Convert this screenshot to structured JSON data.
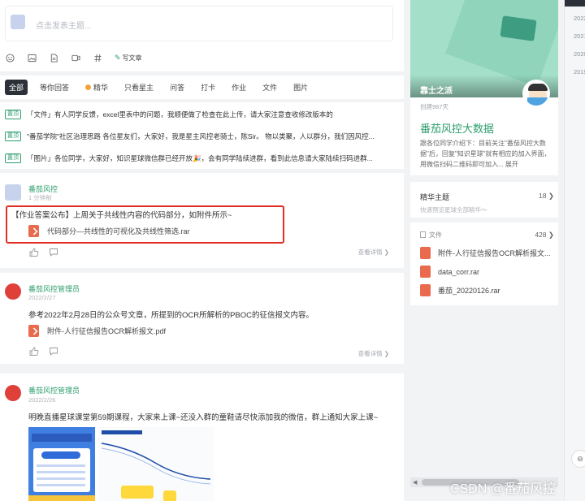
{
  "composer": {
    "placeholder": "点击发表主题..."
  },
  "toolbar": {
    "write_article": "写文章"
  },
  "filters": [
    {
      "label": "全部",
      "active": true
    },
    {
      "label": "等你回答"
    },
    {
      "label": "精华",
      "dot": true
    },
    {
      "label": "只看星主"
    },
    {
      "label": "问答"
    },
    {
      "label": "打卡"
    },
    {
      "label": "作业"
    },
    {
      "label": "文件"
    },
    {
      "label": "图片"
    }
  ],
  "pinned": [
    {
      "tag": "置顶",
      "text": "「文件」有人同学反馈，excel里表中的问题，我顺便做了检查在此上传，请大家注意查收修改版本的"
    },
    {
      "tag": "置顶",
      "text": "\"番茄学院\"社区治理思路 各位星友们，大家好，我是星主风控老骑士，陈Sir。 物以类聚，人以群分，我们因风控..."
    },
    {
      "tag": "置顶",
      "text": "「图片」各位同学，大家好，知识星球微信群已经开放🎉，会有同学陆续进群，看到此信息请大家陆续扫码进群..."
    }
  ],
  "posts": [
    {
      "author": "番茄风控",
      "time": "1 分钟前",
      "body": "【作业答案公布】上周关于共线性内容的代码部分，如附件所示~",
      "file": "代码部分—共线性的可视化及共线性筛选.rar",
      "more": "查看详情 ❯"
    },
    {
      "author": "番茄风控管理员",
      "time": "2022/2/27",
      "body": "参考2022年2月28日的公众号文章，所提到的OCR所解析的PBOC的征信报文内容。",
      "file": "附件-人行征信报告OCR解析报文.pdf",
      "more": "查看详情 ❯"
    },
    {
      "author": "番茄风控管理员",
      "time": "2022/2/26",
      "body": "明晚直播星球课堂第59期课程，大家来上课~还没入群的童鞋请尽快添加我的微信，群上通知大家上课~"
    }
  ],
  "group": {
    "banner_name": "靠士之派",
    "created": "创建987天",
    "name": "番茄风控大数据",
    "desc": "跟各位同学介绍下：目前关注\"番茄风控大数据\"后，回复\"知识星球\"就有相应的加入界面，用微信扫码二维码即可加入... 展开"
  },
  "highlights": {
    "label": "精华主题",
    "count": "18 ❯",
    "sub": "快速预览星球全部精华～"
  },
  "files": {
    "label": "文件",
    "count": "428 ❯",
    "items": [
      "附件-人行征信报告OCR解析报文...",
      "data_corr.rar",
      "番茄_20220126.rar"
    ]
  },
  "timeline": [
    "2022",
    "2021",
    "2020",
    "2019"
  ],
  "watermark": "CSDN @番茄风控",
  "colors": {
    "brand": "#2c9d6e",
    "highlight_box": "#e02e24",
    "file_icon": "#e96a4c",
    "banner": "#a4dfc9"
  }
}
